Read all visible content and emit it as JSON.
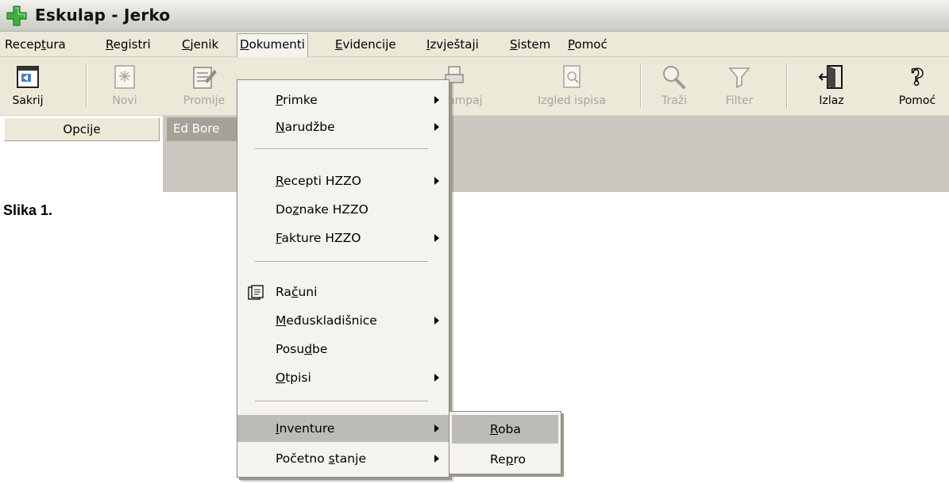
{
  "window": {
    "title": "Eskulap - Jerko",
    "logo_icon": "green-cross-icon",
    "brand_color": "#3cb043"
  },
  "menubar": {
    "items": [
      {
        "label_pre": "Recep",
        "label_ul": "t",
        "label_post": "ura"
      },
      {
        "label_pre": "",
        "label_ul": "R",
        "label_post": "egistri"
      },
      {
        "label_pre": "",
        "label_ul": "C",
        "label_post": "jenik"
      },
      {
        "label_pre": "",
        "label_ul": "D",
        "label_post": "okumenti"
      },
      {
        "label_pre": "",
        "label_ul": "E",
        "label_post": "videncije"
      },
      {
        "label_pre": "",
        "label_ul": "I",
        "label_post": "zvještaji"
      },
      {
        "label_pre": "",
        "label_ul": "S",
        "label_post": "istem"
      },
      {
        "label_pre": "",
        "label_ul": "P",
        "label_post": "omoć"
      }
    ],
    "active": "Dokumenti"
  },
  "toolbar": {
    "buttons": [
      {
        "label": "Sakrij",
        "icon": "hide-panel-icon",
        "enabled": true
      },
      {
        "label": "Novi",
        "icon": "new-document-icon",
        "enabled": false
      },
      {
        "label": "Promije",
        "icon": "edit-document-icon",
        "enabled": false
      },
      {
        "label": "ampaj",
        "icon": "print-icon",
        "enabled": false
      },
      {
        "label": "Izgled ispisa",
        "icon": "print-preview-icon",
        "enabled": false
      },
      {
        "label": "Traži",
        "icon": "search-icon",
        "enabled": false
      },
      {
        "label": "Filter",
        "icon": "filter-icon",
        "enabled": false
      },
      {
        "label": "Izlaz",
        "icon": "exit-door-icon",
        "enabled": true
      },
      {
        "label": "Pomoć",
        "icon": "help-icon",
        "enabled": true
      }
    ]
  },
  "tabs": {
    "opcije": "Opcije",
    "ed": "Ed Bore"
  },
  "caption": "Slika 1.",
  "dropdown": {
    "items": [
      {
        "pre": "",
        "ul": "P",
        "post": "rimke",
        "submenu": true
      },
      {
        "pre": "",
        "ul": "N",
        "post": "arudžbe",
        "submenu": true
      },
      {
        "pre": "",
        "ul": "R",
        "post": "ecepti HZZO",
        "submenu": true
      },
      {
        "pre": "Do",
        "ul": "z",
        "post": "nake HZZO",
        "submenu": false
      },
      {
        "pre": "",
        "ul": "F",
        "post": "akture HZZO",
        "submenu": true
      },
      {
        "pre": "Ra",
        "ul": "č",
        "post": "uni",
        "submenu": false,
        "icon": "invoice-icon"
      },
      {
        "pre": "",
        "ul": "M",
        "post": "eđuskladišnice",
        "submenu": true
      },
      {
        "pre": "Posu",
        "ul": "d",
        "post": "be",
        "submenu": false
      },
      {
        "pre": "",
        "ul": "O",
        "post": "tpisi",
        "submenu": true
      },
      {
        "pre": "",
        "ul": "I",
        "post": "nventure",
        "submenu": true,
        "highlighted": true
      },
      {
        "pre": "Početno ",
        "ul": "s",
        "post": "tanje",
        "submenu": true
      }
    ]
  },
  "submenu": {
    "items": [
      {
        "pre": "",
        "ul": "R",
        "post": "oba",
        "highlighted": true
      },
      {
        "pre": "Re",
        "ul": "p",
        "post": "ro",
        "highlighted": false
      }
    ]
  }
}
